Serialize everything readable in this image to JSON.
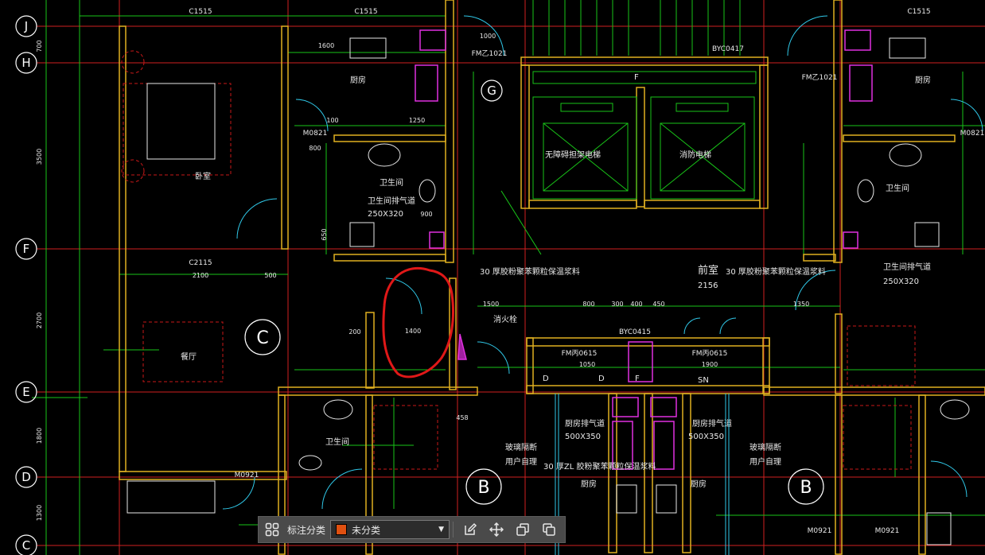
{
  "axis_labels": [
    "J",
    "H",
    "G",
    "F",
    "E",
    "D",
    "C"
  ],
  "zone_labels": [
    "C",
    "B",
    "B"
  ],
  "rooms": [
    "厨房",
    "厨房",
    "卧室",
    "卫生间",
    "卫生间",
    "餐厅",
    "无障碍担架电梯",
    "消防电梯",
    "前室",
    "卫生间",
    "厨房",
    "厨房"
  ],
  "windows": [
    "C1515",
    "C1515",
    "C1515",
    "C2115",
    "FM乙1021",
    "FM乙1021",
    "FM丙0615",
    "FM丙0615",
    "BYC0415",
    "BYC0417",
    "M0821",
    "M0821",
    "M0921",
    "M0921",
    "M0921"
  ],
  "notes": [
    "卫生间排气道",
    "250X320",
    "卫生间排气道",
    "250X320",
    "30 厚胶粉聚苯颗粒保温浆料",
    "30 厚胶粉聚苯颗粒保温浆料",
    "30 厚ZL 胶粉聚苯颗粒保温浆料",
    "消火栓",
    "厨房排气道",
    "500X350",
    "厨房排气道",
    "500X350",
    "玻璃隔断",
    "用户自理",
    "玻璃隔断",
    "用户自理",
    "2156",
    "SN",
    "D",
    "D",
    "F",
    "F"
  ],
  "dimensions": [
    "700",
    "3500",
    "2700",
    "1800",
    "1300",
    "1600",
    "1000",
    "1250",
    "100",
    "800",
    "200",
    "900",
    "650",
    "2100",
    "500",
    "1400",
    "1500",
    "800",
    "300",
    "400",
    "450",
    "1350",
    "1050",
    "1900",
    "458"
  ],
  "highlight_annotation": "1400",
  "toolbar": {
    "grid_icon": "grid-icon",
    "label": "标注分类",
    "selected": "未分类",
    "swatch_color": "#e05010",
    "buttons": [
      "edit-icon",
      "move-icon",
      "copy-icon",
      "paste-icon"
    ]
  }
}
